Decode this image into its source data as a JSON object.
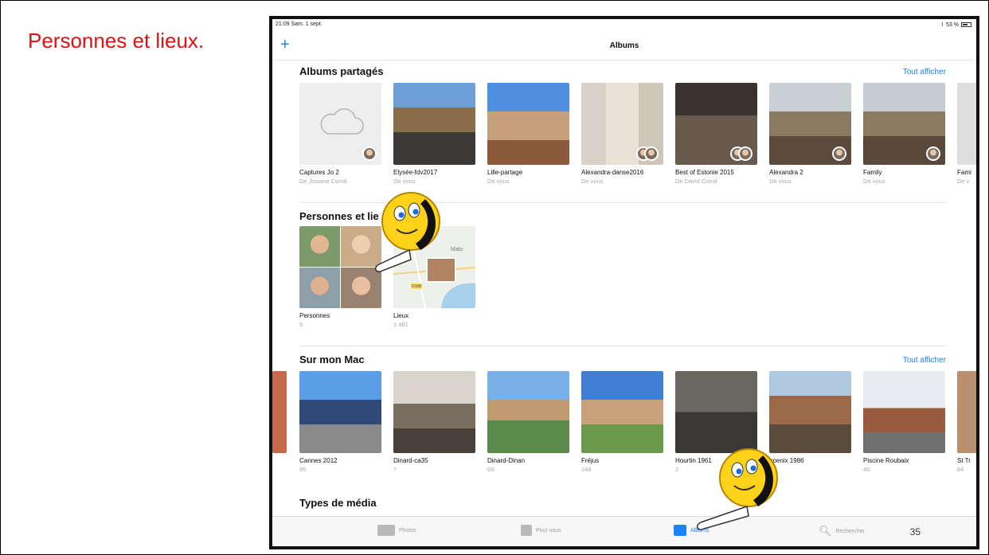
{
  "slide": {
    "title": "Personnes et lieux.",
    "page_number": "35"
  },
  "status_bar": {
    "time_date": "21:09  Sam. 1 sept.",
    "battery": "53 %"
  },
  "nav": {
    "title": "Albums"
  },
  "shared": {
    "title": "Albums partagés",
    "see_all": "Tout afficher",
    "albums": [
      {
        "name": "Captures Jo 2",
        "sub": "De Josiane Cornil"
      },
      {
        "name": "Elysée-fdv2017",
        "sub": "De vous"
      },
      {
        "name": "Lille-partage",
        "sub": "De vous"
      },
      {
        "name": "Alexandra-danse2016",
        "sub": "De vous"
      },
      {
        "name": "Best of Estonie 2015",
        "sub": "De David Cornil"
      },
      {
        "name": "Alexandra 2",
        "sub": "De vous"
      },
      {
        "name": "Family",
        "sub": "De vous"
      },
      {
        "name": "Fami",
        "sub": "De v"
      }
    ]
  },
  "people_places": {
    "title": "Personnes et lie",
    "items": [
      {
        "name": "Personnes",
        "count": "5"
      },
      {
        "name": "Lieux",
        "count": "1 481"
      }
    ],
    "map_labels": {
      "town": "Malo",
      "road": "D168"
    }
  },
  "mac": {
    "title": "Sur mon Mac",
    "see_all": "Tout afficher",
    "albums": [
      {
        "name": "Cannes 2012",
        "count": "85"
      },
      {
        "name": "Dinard-ca35",
        "count": "7"
      },
      {
        "name": "Dinard-Dinan",
        "count": "69"
      },
      {
        "name": "Fréjus",
        "count": "248"
      },
      {
        "name": "Hourtin 1961",
        "count": "2"
      },
      {
        "name": "hoenix 1986",
        "count": ""
      },
      {
        "name": "Piscine Roubaix",
        "count": "40"
      },
      {
        "name": "St Tr",
        "count": "84"
      }
    ]
  },
  "media_types": {
    "title": "Types de média"
  },
  "tabs": [
    {
      "label": "Photos"
    },
    {
      "label": "Pour vous"
    },
    {
      "label": "Albums"
    },
    {
      "label": "Rechercher"
    }
  ]
}
